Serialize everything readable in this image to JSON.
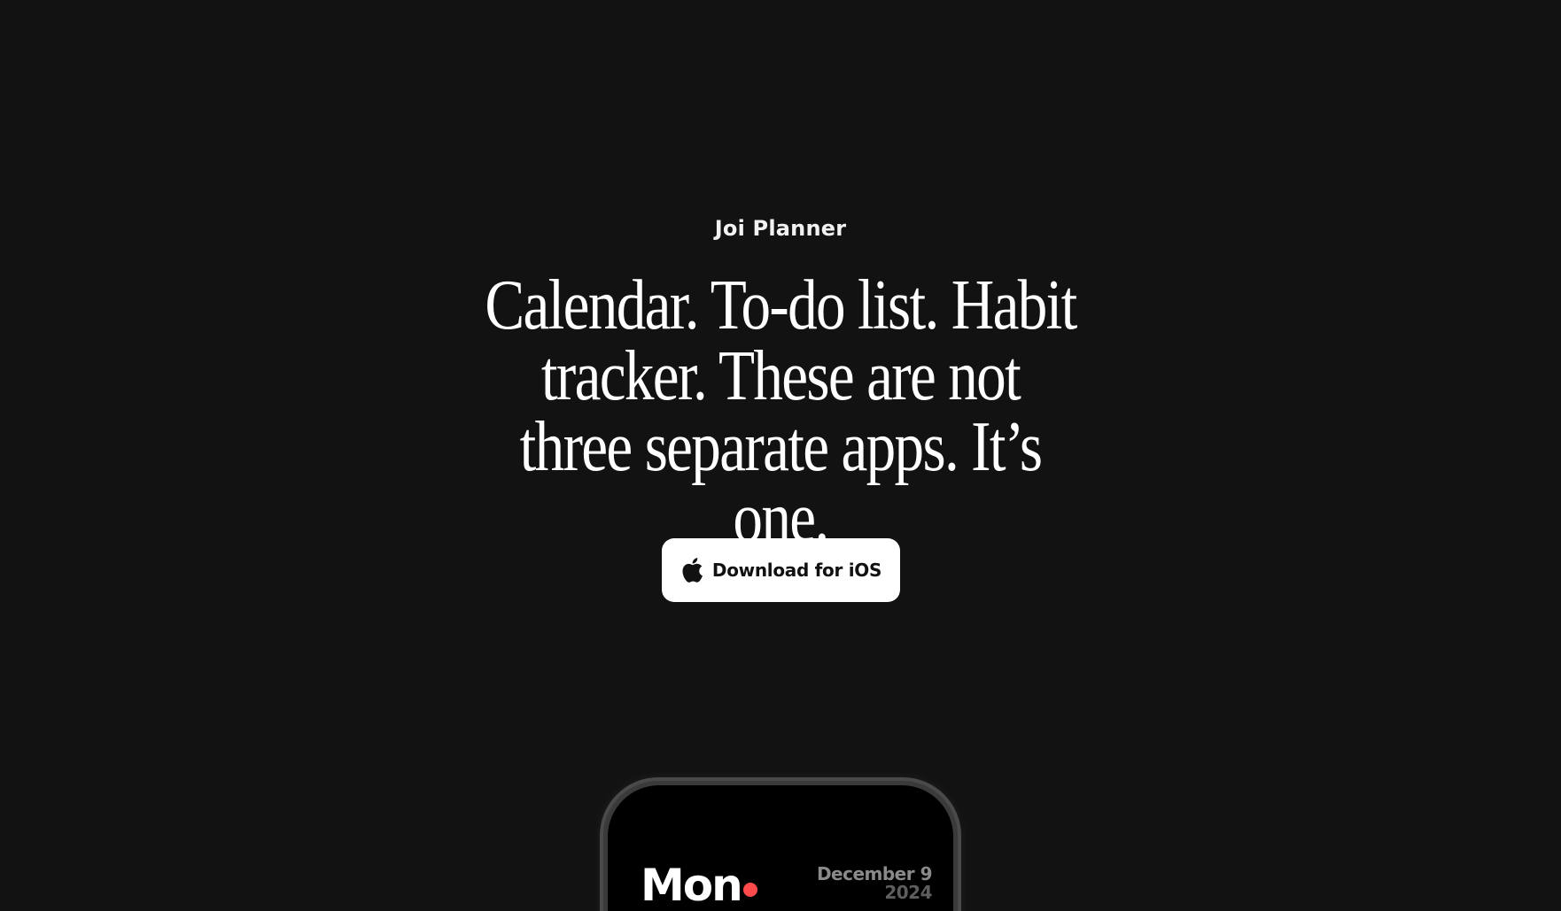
{
  "brand": {
    "name": "Joi Planner"
  },
  "hero": {
    "headline": "Calendar. To-do list. Habit tracker. These are not three separate apps. It’s one."
  },
  "cta": {
    "label": "Download for iOS",
    "icon": "apple-icon"
  },
  "phone_preview": {
    "day": "Mon",
    "date": "December 9",
    "year": "2024",
    "accent_color": "#ff4b4b"
  },
  "colors": {
    "background": "#121212",
    "text": "#ffffff",
    "button_bg": "#ffffff",
    "button_text": "#111111"
  }
}
